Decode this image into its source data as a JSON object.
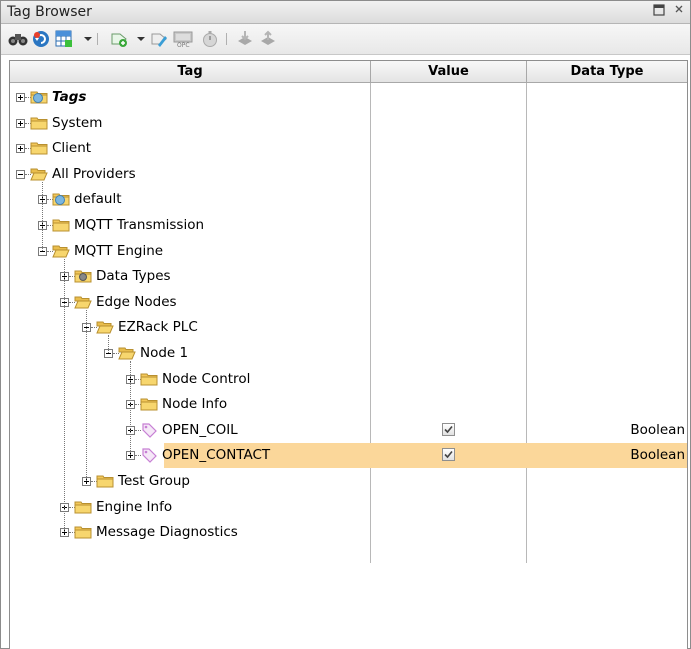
{
  "window": {
    "title": "Tag Browser"
  },
  "toolbar": {
    "icons": [
      "binoculars-icon",
      "refresh-icon",
      "grid-icon",
      "dropdown-arrow-icon",
      "add-tag-icon",
      "dropdown-arrow-icon",
      "edit-tag-icon",
      "opc-icon",
      "timer-icon",
      "import-icon",
      "export-icon"
    ]
  },
  "columns": {
    "tag": "Tag",
    "value": "Value",
    "data_type": "Data Type"
  },
  "tree": [
    {
      "label": "Tags",
      "depth": 0,
      "icon": "tag-provider-icon",
      "expanded": false,
      "italic": true
    },
    {
      "label": "System",
      "depth": 0,
      "icon": "folder-icon",
      "expanded": false
    },
    {
      "label": "Client",
      "depth": 0,
      "icon": "folder-icon",
      "expanded": false
    },
    {
      "label": "All Providers",
      "depth": 0,
      "icon": "folder-open-icon",
      "expanded": true
    },
    {
      "label": "default",
      "depth": 1,
      "icon": "tag-provider-icon",
      "expanded": false
    },
    {
      "label": "MQTT Transmission",
      "depth": 1,
      "icon": "folder-icon",
      "expanded": false
    },
    {
      "label": "MQTT Engine",
      "depth": 1,
      "icon": "folder-open-icon",
      "expanded": true
    },
    {
      "label": "Data Types",
      "depth": 2,
      "icon": "data-types-icon",
      "expanded": false
    },
    {
      "label": "Edge Nodes",
      "depth": 2,
      "icon": "folder-open-icon",
      "expanded": true
    },
    {
      "label": "EZRack PLC",
      "depth": 3,
      "icon": "folder-open-icon",
      "expanded": true
    },
    {
      "label": "Node 1",
      "depth": 4,
      "icon": "folder-open-icon",
      "expanded": true
    },
    {
      "label": "Node Control",
      "depth": 5,
      "icon": "folder-icon",
      "expanded": false
    },
    {
      "label": "Node Info",
      "depth": 5,
      "icon": "folder-icon",
      "expanded": false
    },
    {
      "label": "OPEN_COIL",
      "depth": 5,
      "icon": "tag-icon",
      "expanded": false,
      "value": "checked",
      "data_type": "Boolean"
    },
    {
      "label": "OPEN_CONTACT",
      "depth": 5,
      "icon": "tag-icon",
      "expanded": false,
      "value": "checked",
      "data_type": "Boolean",
      "selected": true
    },
    {
      "label": "Test Group",
      "depth": 3,
      "icon": "folder-icon",
      "expanded": false
    },
    {
      "label": "Engine Info",
      "depth": 2,
      "icon": "folder-icon",
      "expanded": false
    },
    {
      "label": "Message Diagnostics",
      "depth": 2,
      "icon": "folder-icon",
      "expanded": false
    }
  ],
  "colors": {
    "selection": "#fbd79a",
    "folder": "#f3c85a",
    "tag": "#c77fd4"
  }
}
